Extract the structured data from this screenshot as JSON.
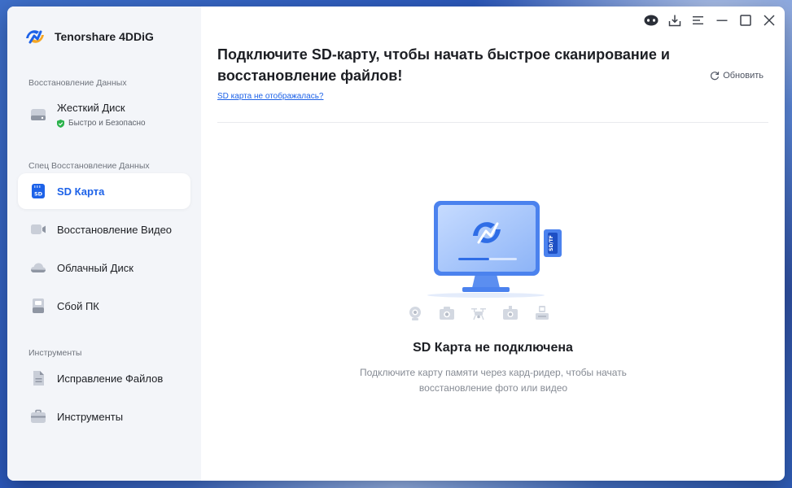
{
  "app": {
    "name": "Tenorshare 4DDiG"
  },
  "sidebar": {
    "sections": [
      {
        "title": "Восстановление Данных",
        "items": [
          {
            "label": "Жесткий Диск",
            "sub": "Быстро и Безопасно",
            "icon": "hard-disk-icon"
          }
        ]
      },
      {
        "title": "Спец Восстановление Данных",
        "items": [
          {
            "label": "SD Карта",
            "icon": "sd-card-icon",
            "active": true
          },
          {
            "label": "Восстановление Видео",
            "icon": "video-camera-icon"
          },
          {
            "label": "Облачный Диск",
            "icon": "cloud-icon"
          },
          {
            "label": "Сбой ПК",
            "icon": "pc-crash-icon"
          }
        ]
      },
      {
        "title": "Инструменты",
        "items": [
          {
            "label": "Исправление Файлов",
            "icon": "file-repair-icon"
          },
          {
            "label": "Инструменты",
            "icon": "toolbox-icon"
          }
        ]
      }
    ]
  },
  "titlebar": {
    "icons": [
      "assistant-icon",
      "download-icon",
      "menu-icon",
      "minimize-icon",
      "maximize-icon",
      "close-icon"
    ]
  },
  "main": {
    "title": "Подключите SD-карту, чтобы начать быстрое сканирование и восстановление файлов!",
    "refresh_label": "Обновить",
    "help_link": "SD карта не отображалась?",
    "illustration_card_label": "SD/TF",
    "device_icons": [
      "webcam-icon",
      "camera-icon",
      "drone-icon",
      "dashcam-icon",
      "card-reader-icon"
    ],
    "empty_title": "SD Карта не подключена",
    "empty_desc": "Подключите карту памяти через кард-ридер, чтобы начать восстановление фото или видео"
  },
  "colors": {
    "accent": "#1d62e8",
    "sidebar_bg": "#f3f5f9",
    "text_primary": "#1d1f24",
    "text_secondary": "#868b94"
  }
}
